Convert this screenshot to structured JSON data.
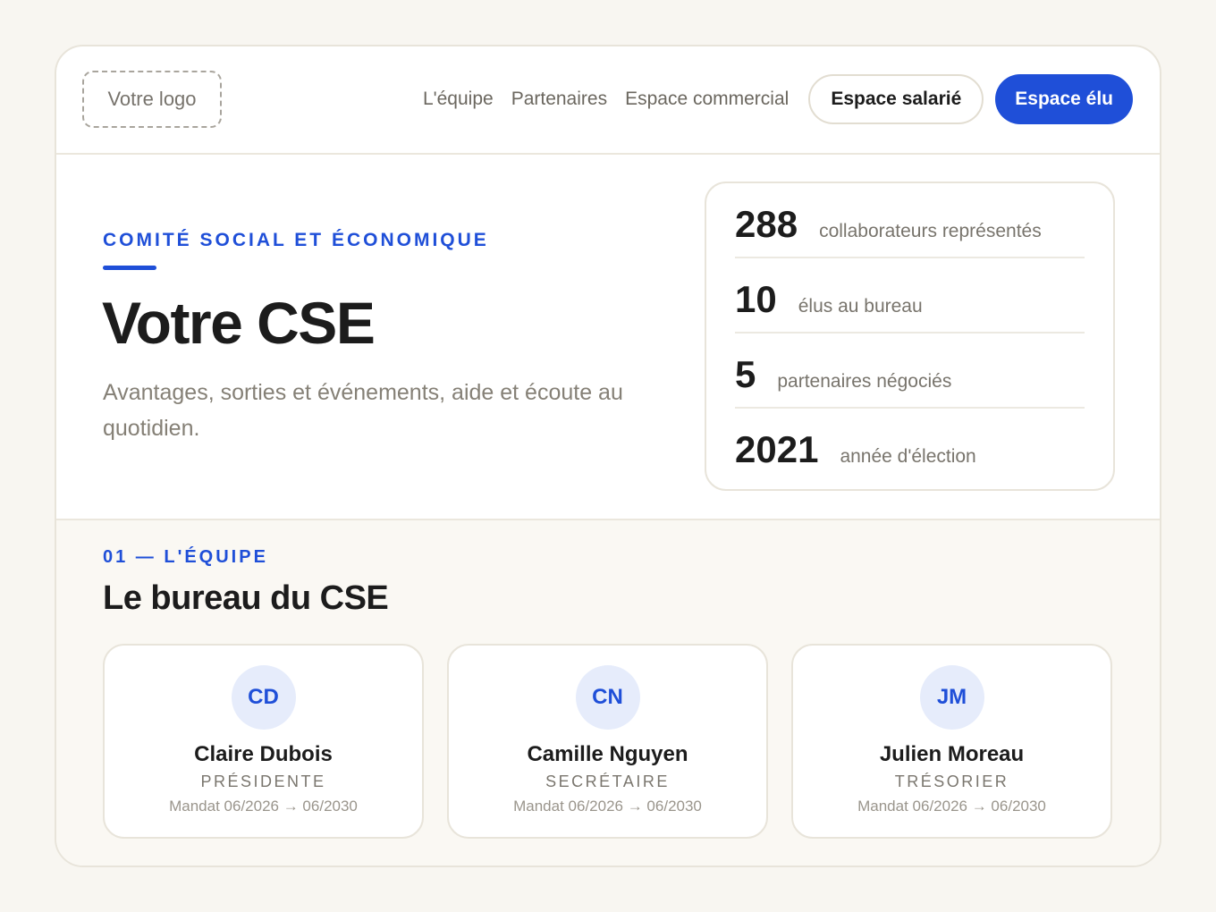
{
  "header": {
    "logo_label": "Votre logo",
    "nav": [
      "L'équipe",
      "Partenaires",
      "Espace commercial"
    ],
    "btn_salarie": "Espace salarié",
    "btn_elu": "Espace élu"
  },
  "hero": {
    "eyebrow": "COMITÉ SOCIAL ET ÉCONOMIQUE",
    "title": "Votre CSE",
    "subtitle": "Avantages, sorties et événements, aide et écoute au quotidien.",
    "stats": [
      {
        "value": "288",
        "label": "collaborateurs représentés"
      },
      {
        "value": "10",
        "label": "élus au bureau"
      },
      {
        "value": "5",
        "label": "partenaires négociés"
      },
      {
        "value": "2021",
        "label": "année d'élection"
      }
    ]
  },
  "team": {
    "eyebrow": "01 — L'ÉQUIPE",
    "title": "Le bureau du CSE",
    "members": [
      {
        "initials": "CD",
        "name": "Claire Dubois",
        "role": "PRÉSIDENTE",
        "mandate": "Mandat 06/2026 → 06/2030"
      },
      {
        "initials": "CN",
        "name": "Camille Nguyen",
        "role": "SECRÉTAIRE",
        "mandate": "Mandat 06/2026 → 06/2030"
      },
      {
        "initials": "JM",
        "name": "Julien Moreau",
        "role": "TRÉSORIER",
        "mandate": "Mandat 06/2026 → 06/2030"
      }
    ]
  },
  "colors": {
    "accent": "#1f4fd8",
    "background": "#f8f6f1",
    "avatar_bg": "#e6ecfb"
  }
}
